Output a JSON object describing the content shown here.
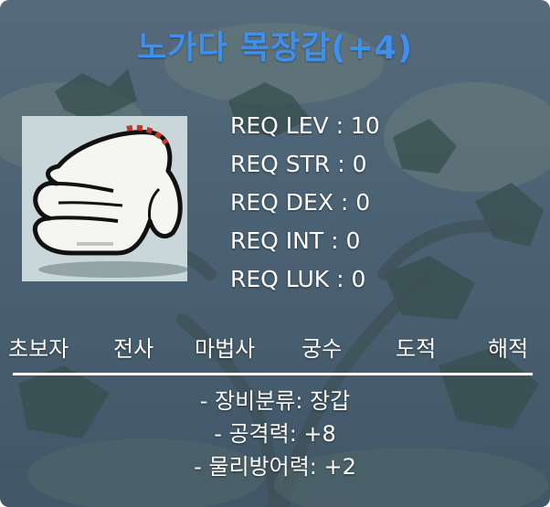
{
  "item": {
    "title": "노가다 목장갑(+4)",
    "title_color": "#3d8ff0",
    "icon": "white-work-glove-icon"
  },
  "requirements": [
    "REQ LEV : 10",
    "REQ STR : 0",
    "REQ DEX : 0",
    "REQ INT : 0",
    "REQ LUK : 0"
  ],
  "jobs": [
    "초보자",
    "전사",
    "마법사",
    "궁수",
    "도적",
    "해적"
  ],
  "stats": [
    "- 장비분류: 장갑",
    "- 공격력: +8",
    "- 물리방어력: +2"
  ]
}
